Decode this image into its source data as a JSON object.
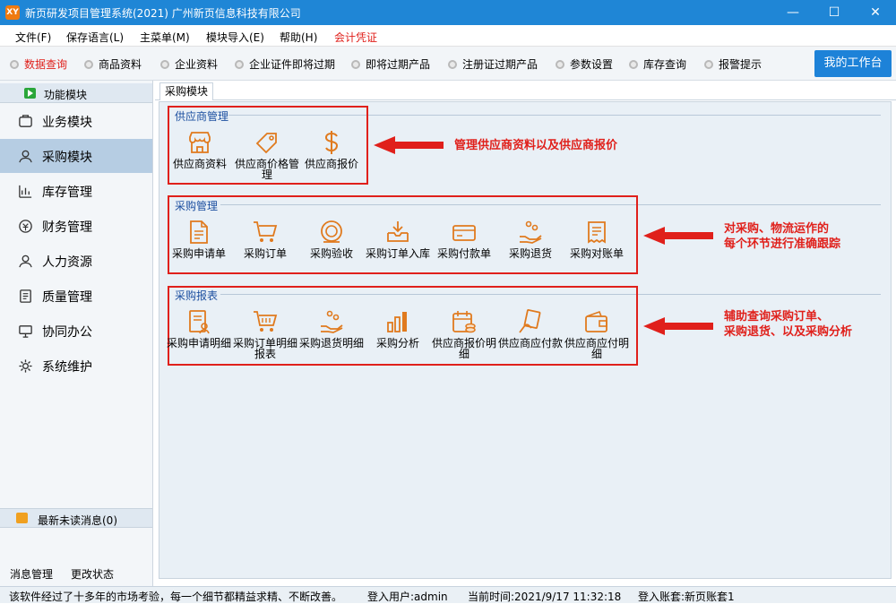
{
  "window": {
    "title": "新页研发项目管理系统(2021) 广州新页信息科技有限公司",
    "app_icon_text": "XY",
    "min_glyph": "—",
    "max_glyph": "☐",
    "close_glyph": "✕"
  },
  "menubar": {
    "items": [
      "文件(F)",
      "保存语言(L)",
      "主菜单(M)",
      "模块导入(E)",
      "帮助(H)",
      "会计凭证"
    ]
  },
  "toolbar": {
    "items": [
      "数据查询",
      "商品资料",
      "企业资料",
      "企业证件即将过期",
      "即将过期产品",
      "注册证过期产品",
      "参数设置",
      "库存查询",
      "报警提示"
    ],
    "workbench_label": "我的工作台"
  },
  "sidebar": {
    "header": "功能模块",
    "items": [
      {
        "label": "业务模块",
        "icon": "business-icon"
      },
      {
        "label": "采购模块",
        "icon": "purchase-user-icon"
      },
      {
        "label": "库存管理",
        "icon": "inventory-chart-icon"
      },
      {
        "label": "财务管理",
        "icon": "finance-coin-icon"
      },
      {
        "label": "人力资源",
        "icon": "person-icon"
      },
      {
        "label": "质量管理",
        "icon": "document-icon"
      },
      {
        "label": "协同办公",
        "icon": "monitor-icon"
      },
      {
        "label": "系统维护",
        "icon": "gear-icon"
      }
    ],
    "active_index": 1,
    "messages_label": "最新未读消息(0)",
    "bottom_links": [
      "消息管理",
      "更改状态"
    ]
  },
  "main": {
    "tab_label": "采购模块",
    "groups": [
      {
        "title": "供应商管理",
        "modules": [
          {
            "label": "供应商资料",
            "icon": "store-icon"
          },
          {
            "label": "供应商价格管理",
            "icon": "price-tag-icon"
          },
          {
            "label": "供应商报价",
            "icon": "dollar-icon"
          }
        ],
        "note_lines": [
          "管理供应商资料以及供应商报价"
        ]
      },
      {
        "title": "采购管理",
        "modules": [
          {
            "label": "采购申请单",
            "icon": "document-icon"
          },
          {
            "label": "采购订单",
            "icon": "cart-icon"
          },
          {
            "label": "采购验收",
            "icon": "coin-check-icon"
          },
          {
            "label": "采购订单入库",
            "icon": "inbox-download-icon"
          },
          {
            "label": "采购付款单",
            "icon": "wallet-icon"
          },
          {
            "label": "采购退货",
            "icon": "hand-coins-icon"
          },
          {
            "label": "采购对账单",
            "icon": "receipt-icon"
          }
        ],
        "note_lines": [
          "对采购、物流运作的",
          "每个环节进行准确跟踪"
        ]
      },
      {
        "title": "采购报表",
        "modules": [
          {
            "label": "采购申请明细",
            "icon": "form-user-icon"
          },
          {
            "label": "采购订单明细报表",
            "icon": "cart-icon"
          },
          {
            "label": "采购退货明细",
            "icon": "hand-coins-icon"
          },
          {
            "label": "采购分析",
            "icon": "bar-chart-icon"
          },
          {
            "label": "供应商报价明细",
            "icon": "calendar-coins-icon"
          },
          {
            "label": "供应商应付款",
            "icon": "hand-card-icon"
          },
          {
            "label": "供应商应付明细",
            "icon": "wallet-icon"
          }
        ],
        "note_lines": [
          "辅助查询采购订单、",
          "采购退货、以及采购分析"
        ]
      }
    ]
  },
  "statusbar": {
    "message": "该软件经过了十多年的市场考验，每一个细节都精益求精、不断改善。",
    "user": "登入用户:admin",
    "time": "当前时间:2021/9/17 11:32:18",
    "account": "登入账套:新页账套1"
  },
  "colors": {
    "titlebar": "#1f86d6",
    "accent_orange": "#e07a1e",
    "annotation_red": "#e0201b",
    "group_title_blue": "#1c4fa0"
  }
}
